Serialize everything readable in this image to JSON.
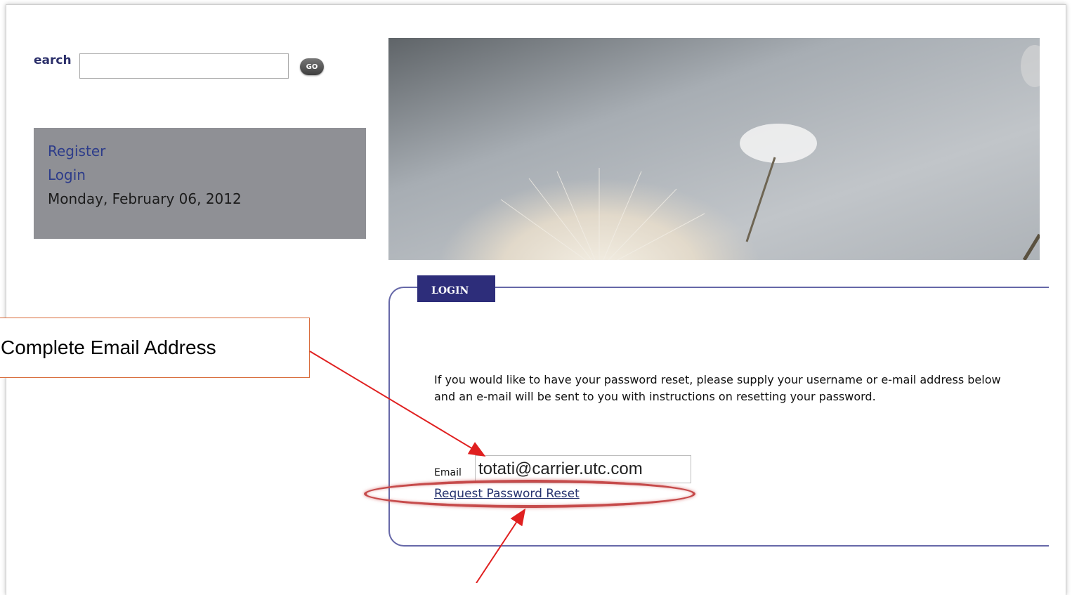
{
  "search": {
    "label": "earch",
    "value": "",
    "go_label": "GO"
  },
  "user_box": {
    "register": "Register",
    "login": "Login",
    "date": "Monday, February 06, 2012"
  },
  "login_panel": {
    "tab_label": "LOGIN",
    "info_text": "If you would like to have your password reset, please supply your username or e-mail address below and an e-mail will be sent to you with instructions on resetting your password.",
    "email_label": "Email",
    "email_value": "totati@carrier.utc.com",
    "reset_link": "Request Password Reset"
  },
  "annotation": {
    "callout_text": "Complete Email Address"
  },
  "colors": {
    "tab_bg": "#2d2d7a",
    "panel_border": "#6668a8",
    "user_box_bg": "#8f9095",
    "annotation_red": "#e02020"
  }
}
